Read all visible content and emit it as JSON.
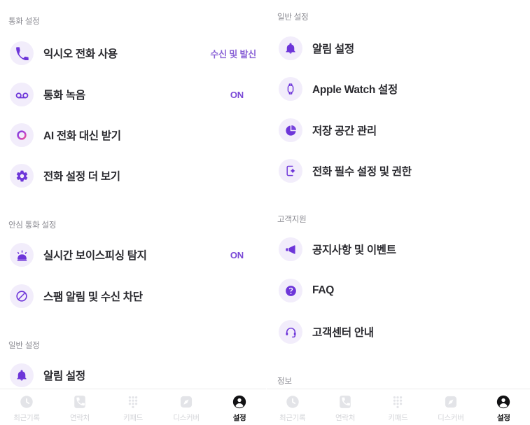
{
  "app": {
    "accent_purple": "#7a49d6",
    "icon_bg": "#f2edfb",
    "label_color": "#2b2b30",
    "section_color": "#8b8b92",
    "nav_inactive_color": "#d3d4d8",
    "nav_active_color": "#121214"
  },
  "left_panel": {
    "sections": [
      {
        "title": "통화 설정",
        "items": [
          {
            "icon": "phone-icon",
            "label": "익시오 전화 사용",
            "value": "수신 및 발신"
          },
          {
            "icon": "voicemail-icon",
            "label": "통화 녹음",
            "value": "ON"
          },
          {
            "icon": "ai-ring-icon",
            "label": "AI 전화 대신 받기",
            "value": ""
          },
          {
            "icon": "gear-icon",
            "label": "전화 설정 더 보기",
            "value": ""
          }
        ]
      },
      {
        "title": "안심 통화 설정",
        "items": [
          {
            "icon": "siren-icon",
            "label": "실시간 보이스피싱 탐지",
            "value": "ON"
          },
          {
            "icon": "block-icon",
            "label": "스팸 알림 및 수신 차단",
            "value": ""
          }
        ]
      },
      {
        "title": "일반 설정",
        "items": [
          {
            "icon": "bell-icon",
            "label": "알림 설정",
            "value": ""
          }
        ]
      }
    ]
  },
  "right_panel": {
    "sections": [
      {
        "title": "일반 설정",
        "items": [
          {
            "icon": "bell-icon",
            "label": "알림 설정",
            "value": ""
          },
          {
            "icon": "watch-icon",
            "label": "Apple Watch 설정",
            "value": ""
          },
          {
            "icon": "pie-chart-icon",
            "label": "저장 공간 관리",
            "value": ""
          },
          {
            "icon": "phone-gear-icon",
            "label": "전화 필수 설정 및 권한",
            "value": ""
          }
        ]
      },
      {
        "title": "고객지원",
        "items": [
          {
            "icon": "megaphone-icon",
            "label": "공지사항 및 이벤트",
            "value": ""
          },
          {
            "icon": "question-icon",
            "label": "FAQ",
            "value": ""
          },
          {
            "icon": "headset-icon",
            "label": "고객센터 안내",
            "value": ""
          }
        ]
      },
      {
        "title": "정보",
        "items": []
      }
    ]
  },
  "bottom_nav": {
    "items": [
      {
        "icon": "clock-icon",
        "label": "최근기록",
        "active": false
      },
      {
        "icon": "contacts-icon",
        "label": "연락처",
        "active": false
      },
      {
        "icon": "keypad-icon",
        "label": "키패드",
        "active": false
      },
      {
        "icon": "discover-icon",
        "label": "디스커버",
        "active": false
      },
      {
        "icon": "person-icon",
        "label": "설정",
        "active": true
      }
    ]
  }
}
